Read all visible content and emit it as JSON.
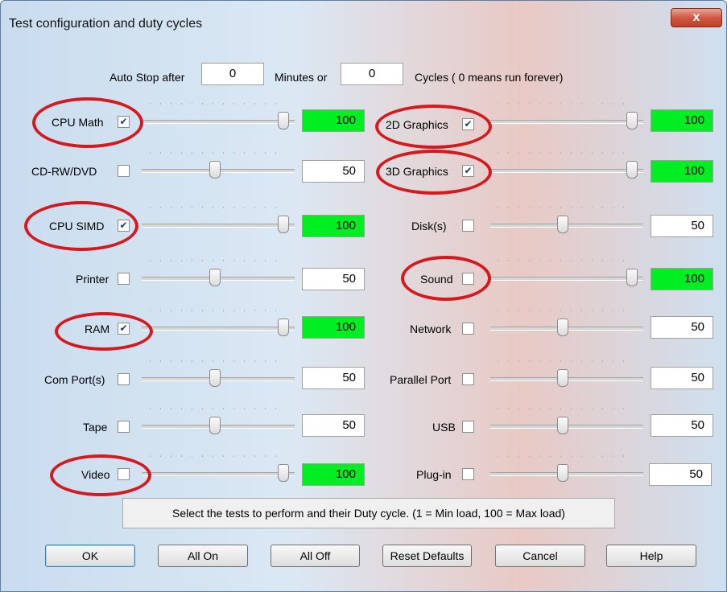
{
  "window": {
    "title": "Test configuration and duty cycles",
    "close_glyph": "x"
  },
  "autostop": {
    "prefix": "Auto Stop after",
    "minutes": "0",
    "minutes_label": "Minutes or",
    "cycles": "0",
    "cycles_label": "Cycles ( 0 means run forever)"
  },
  "tests": {
    "cpu_math": {
      "label": "CPU Math",
      "checked": true,
      "duty": "100"
    },
    "cdrw_dvd": {
      "label": "CD-RW/DVD",
      "checked": false,
      "duty": "50"
    },
    "cpu_simd": {
      "label": "CPU SIMD",
      "checked": true,
      "duty": "100"
    },
    "printer": {
      "label": "Printer",
      "checked": false,
      "duty": "50"
    },
    "ram": {
      "label": "RAM",
      "checked": true,
      "duty": "100"
    },
    "com_ports": {
      "label": "Com Port(s)",
      "checked": false,
      "duty": "50"
    },
    "tape": {
      "label": "Tape",
      "checked": false,
      "duty": "50"
    },
    "video": {
      "label": "Video",
      "checked": false,
      "duty": "100"
    },
    "graphics_2d": {
      "label": "2D Graphics",
      "checked": true,
      "duty": "100"
    },
    "graphics_3d": {
      "label": "3D Graphics",
      "checked": true,
      "duty": "100"
    },
    "disks": {
      "label": "Disk(s)",
      "checked": false,
      "duty": "50"
    },
    "sound": {
      "label": "Sound",
      "checked": false,
      "duty": "100"
    },
    "network": {
      "label": "Network",
      "checked": false,
      "duty": "50"
    },
    "parallel_port": {
      "label": "Parallel Port",
      "checked": false,
      "duty": "50"
    },
    "usb": {
      "label": "USB",
      "checked": false,
      "duty": "50"
    },
    "plugin": {
      "label": "Plug-in",
      "checked": false,
      "duty": "50"
    }
  },
  "info": "Select the tests to perform and their Duty cycle. (1 = Min load, 100 = Max load)",
  "buttons": {
    "ok": "OK",
    "all_on": "All On",
    "all_off": "All Off",
    "reset": "Reset Defaults",
    "cancel": "Cancel",
    "help": "Help"
  },
  "colors": {
    "full_load": "#00ee22",
    "highlight_circle": "#d41a1f"
  }
}
